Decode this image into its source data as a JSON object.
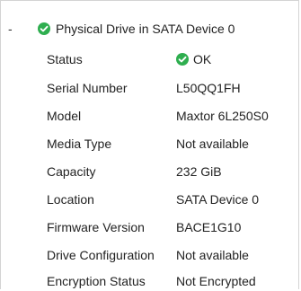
{
  "node": {
    "toggle": "-",
    "title": "Physical Drive in SATA Device 0",
    "status_icon": "ok-check-icon",
    "status_color": "#2eae4f"
  },
  "properties": [
    {
      "label": "Status",
      "value": "OK",
      "icon": "ok-check-icon"
    },
    {
      "label": "Serial Number",
      "value": "L50QQ1FH"
    },
    {
      "label": "Model",
      "value": "Maxtor 6L250S0"
    },
    {
      "label": "Media Type",
      "value": "Not available"
    },
    {
      "label": "Capacity",
      "value": "232 GiB"
    },
    {
      "label": "Location",
      "value": "SATA Device 0"
    },
    {
      "label": "Firmware Version",
      "value": "BACE1G10"
    },
    {
      "label": "Drive Configuration",
      "value": "Not available"
    },
    {
      "label": "Encryption Status",
      "value": "Not Encrypted"
    }
  ]
}
